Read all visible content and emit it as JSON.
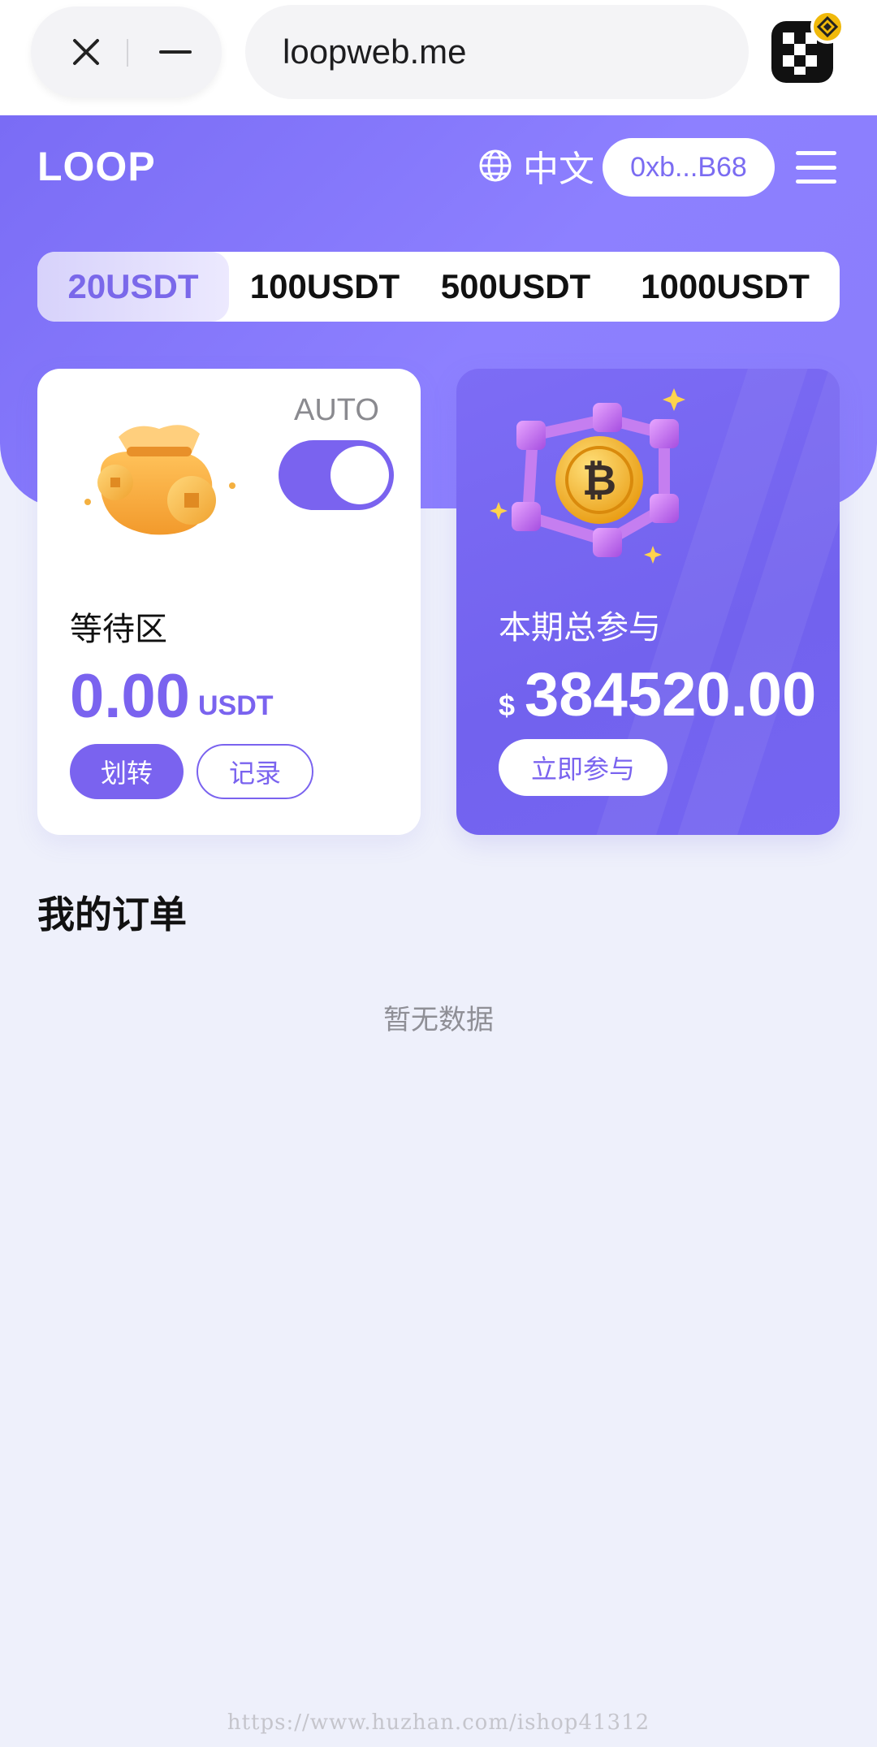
{
  "browser": {
    "url": "loopweb.me"
  },
  "header": {
    "logo": "LOOP",
    "language": "中文",
    "wallet_address": "0xb...B68"
  },
  "amount_tabs": [
    {
      "label": "20USDT",
      "active": true
    },
    {
      "label": "100USDT",
      "active": false
    },
    {
      "label": "500USDT",
      "active": false
    },
    {
      "label": "1000USDT",
      "active": false
    }
  ],
  "wait_card": {
    "auto_label": "AUTO",
    "auto_enabled": true,
    "title": "等待区",
    "amount": "0.00",
    "unit": "USDT",
    "transfer_label": "划转",
    "record_label": "记录"
  },
  "total_card": {
    "title": "本期总参与",
    "currency": "$",
    "amount": "384520.00",
    "join_label": "立即参与"
  },
  "orders": {
    "title": "我的订单",
    "empty_text": "暂无数据"
  },
  "watermark": "https://www.huzhan.com/ishop41312",
  "colors": {
    "primary": "#7a63ef",
    "hero": "#8d80ff",
    "background": "#eef0fb"
  }
}
